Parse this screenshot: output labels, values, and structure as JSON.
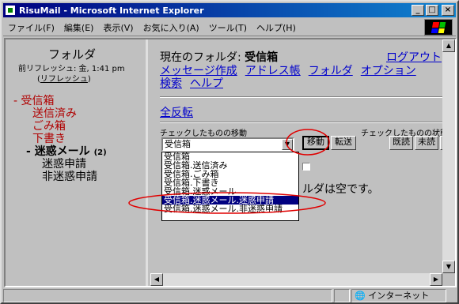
{
  "window": {
    "title": "RisuMail - Microsoft Internet Explorer"
  },
  "menu": [
    "ファイル(F)",
    "編集(E)",
    "表示(V)",
    "お気に入り(A)",
    "ツール(T)",
    "ヘルプ(H)"
  ],
  "left": {
    "title": "フォルダ",
    "last_refresh": "前リフレッシュ: 金, 1:41 pm",
    "refresh_link": "リフレッシュ",
    "inbox": "受信箱",
    "sent": "送信済み",
    "trash": "ごみ箱",
    "drafts": "下書き",
    "spam": "迷惑メール",
    "spam_count": "(2)",
    "spam_report": "迷惑申請",
    "notspam_report": "非迷惑申請"
  },
  "right": {
    "current_folder_label": "現在のフォルダ:",
    "current_folder": "受信箱",
    "logout": "ログアウト",
    "links": [
      "メッセージ作成",
      "アドレス帳",
      "フォルダ",
      "オプション",
      "検索",
      "ヘルプ"
    ],
    "select_all": "全反転",
    "move_label": "チェックしたものの移動",
    "state_label": "チェックしたものの状態変",
    "select_value": "受信箱",
    "move_button": "移動",
    "forward_button": "転送",
    "read_button": "既読",
    "unread_button": "未読",
    "delete_button": "削除",
    "options": [
      "受信箱",
      "受信箱.送信済み",
      "受信箱.ごみ箱",
      "受信箱.下書き",
      "受信箱.迷惑メール",
      "受信箱.迷惑メール.迷惑申請",
      "受信箱.迷惑メール.非迷惑申請"
    ],
    "selected_option_index": 5,
    "empty_message": "ルダは空です。"
  },
  "status": {
    "zone": "インターネット"
  },
  "colors": {
    "annotation": "#e00000",
    "titlebar": "#000080",
    "link": "#0000cc",
    "folder": "#b00000"
  }
}
